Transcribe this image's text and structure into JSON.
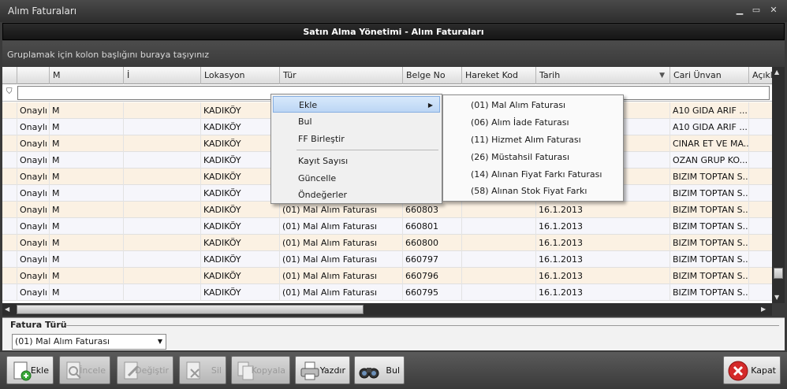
{
  "window": {
    "title": "Alım Faturaları"
  },
  "header": {
    "title": "Satın Alma Yönetimi - Alım Faturaları"
  },
  "group_panel": {
    "text": "Gruplamak için kolon başlığını buraya taşıyınız"
  },
  "grid": {
    "columns": [
      "",
      "M",
      "İ",
      "Lokasyon",
      "Tür",
      "Belge No",
      "Hareket Kod",
      "Tarih",
      "Cari Ünvan",
      "Açıkl"
    ],
    "rows": [
      {
        "durum": "Onaylı",
        "m": "M",
        "lokasyon": "KADIKÖY",
        "tur": "",
        "belge_no": "",
        "tarih": "",
        "cari": "A10 GIDA ARIF ..."
      },
      {
        "durum": "Onaylı",
        "m": "M",
        "lokasyon": "KADIKÖY",
        "tur": "",
        "belge_no": "",
        "tarih": "",
        "cari": "A10 GIDA ARIF ..."
      },
      {
        "durum": "Onaylı",
        "m": "M",
        "lokasyon": "KADIKÖY",
        "tur": "",
        "belge_no": "",
        "tarih": "",
        "cari": "CINAR ET VE MA..."
      },
      {
        "durum": "Onaylı",
        "m": "M",
        "lokasyon": "KADIKÖY",
        "tur": "",
        "belge_no": "",
        "tarih": "",
        "cari": "OZAN GRUP KO..."
      },
      {
        "durum": "Onaylı",
        "m": "M",
        "lokasyon": "KADIKÖY",
        "tur": "",
        "belge_no": "",
        "tarih": "",
        "cari": "BIZIM TOPTAN S..."
      },
      {
        "durum": "Onaylı",
        "m": "M",
        "lokasyon": "KADIKÖY",
        "tur": "",
        "belge_no": "",
        "tarih": "",
        "cari": "BIZIM TOPTAN S..."
      },
      {
        "durum": "Onaylı",
        "m": "M",
        "lokasyon": "KADIKÖY",
        "tur": "(01) Mal Alım Faturası",
        "belge_no": "660803",
        "tarih": "16.1.2013",
        "cari": "BIZIM TOPTAN S..."
      },
      {
        "durum": "Onaylı",
        "m": "M",
        "lokasyon": "KADIKÖY",
        "tur": "(01) Mal Alım Faturası",
        "belge_no": "660801",
        "tarih": "16.1.2013",
        "cari": "BIZIM TOPTAN S..."
      },
      {
        "durum": "Onaylı",
        "m": "M",
        "lokasyon": "KADIKÖY",
        "tur": "(01) Mal Alım Faturası",
        "belge_no": "660800",
        "tarih": "16.1.2013",
        "cari": "BIZIM TOPTAN S..."
      },
      {
        "durum": "Onaylı",
        "m": "M",
        "lokasyon": "KADIKÖY",
        "tur": "(01) Mal Alım Faturası",
        "belge_no": "660797",
        "tarih": "16.1.2013",
        "cari": "BIZIM TOPTAN S..."
      },
      {
        "durum": "Onaylı",
        "m": "M",
        "lokasyon": "KADIKÖY",
        "tur": "(01) Mal Alım Faturası",
        "belge_no": "660796",
        "tarih": "16.1.2013",
        "cari": "BIZIM TOPTAN S..."
      },
      {
        "durum": "Onaylı",
        "m": "M",
        "lokasyon": "KADIKÖY",
        "tur": "(01) Mal Alım Faturası",
        "belge_no": "660795",
        "tarih": "16.1.2013",
        "cari": "BIZIM TOPTAN S..."
      }
    ]
  },
  "context_menu": {
    "items": [
      "Ekle",
      "Bul",
      "FF Birleştir",
      "Kayıt Sayısı",
      "Güncelle",
      "Öndeğerler"
    ],
    "submenu": [
      "(01) Mal Alım Faturası",
      "(06) Alım İade Faturası",
      "(11) Hizmet Alım Faturası",
      "(26) Müstahsil Faturası",
      "(14) Alınan Fiyat Farkı Faturası",
      "(58) Alınan Stok Fiyat Farkı"
    ]
  },
  "fatura_turu": {
    "label": "Fatura Türü",
    "selected": "(01) Mal Alım Faturası"
  },
  "toolbar": {
    "ekle": "Ekle",
    "incele": "İncele",
    "degistir": "Değiştir",
    "sil": "Sil",
    "kopyala": "Kopyala",
    "yazdir": "Yazdır",
    "bul": "Bul",
    "kapat": "Kapat"
  },
  "colors": {
    "accent": "#bcd6f4",
    "row_odd": "#fbf1e3",
    "row_even": "#f6f6fb",
    "header": "#151515"
  }
}
